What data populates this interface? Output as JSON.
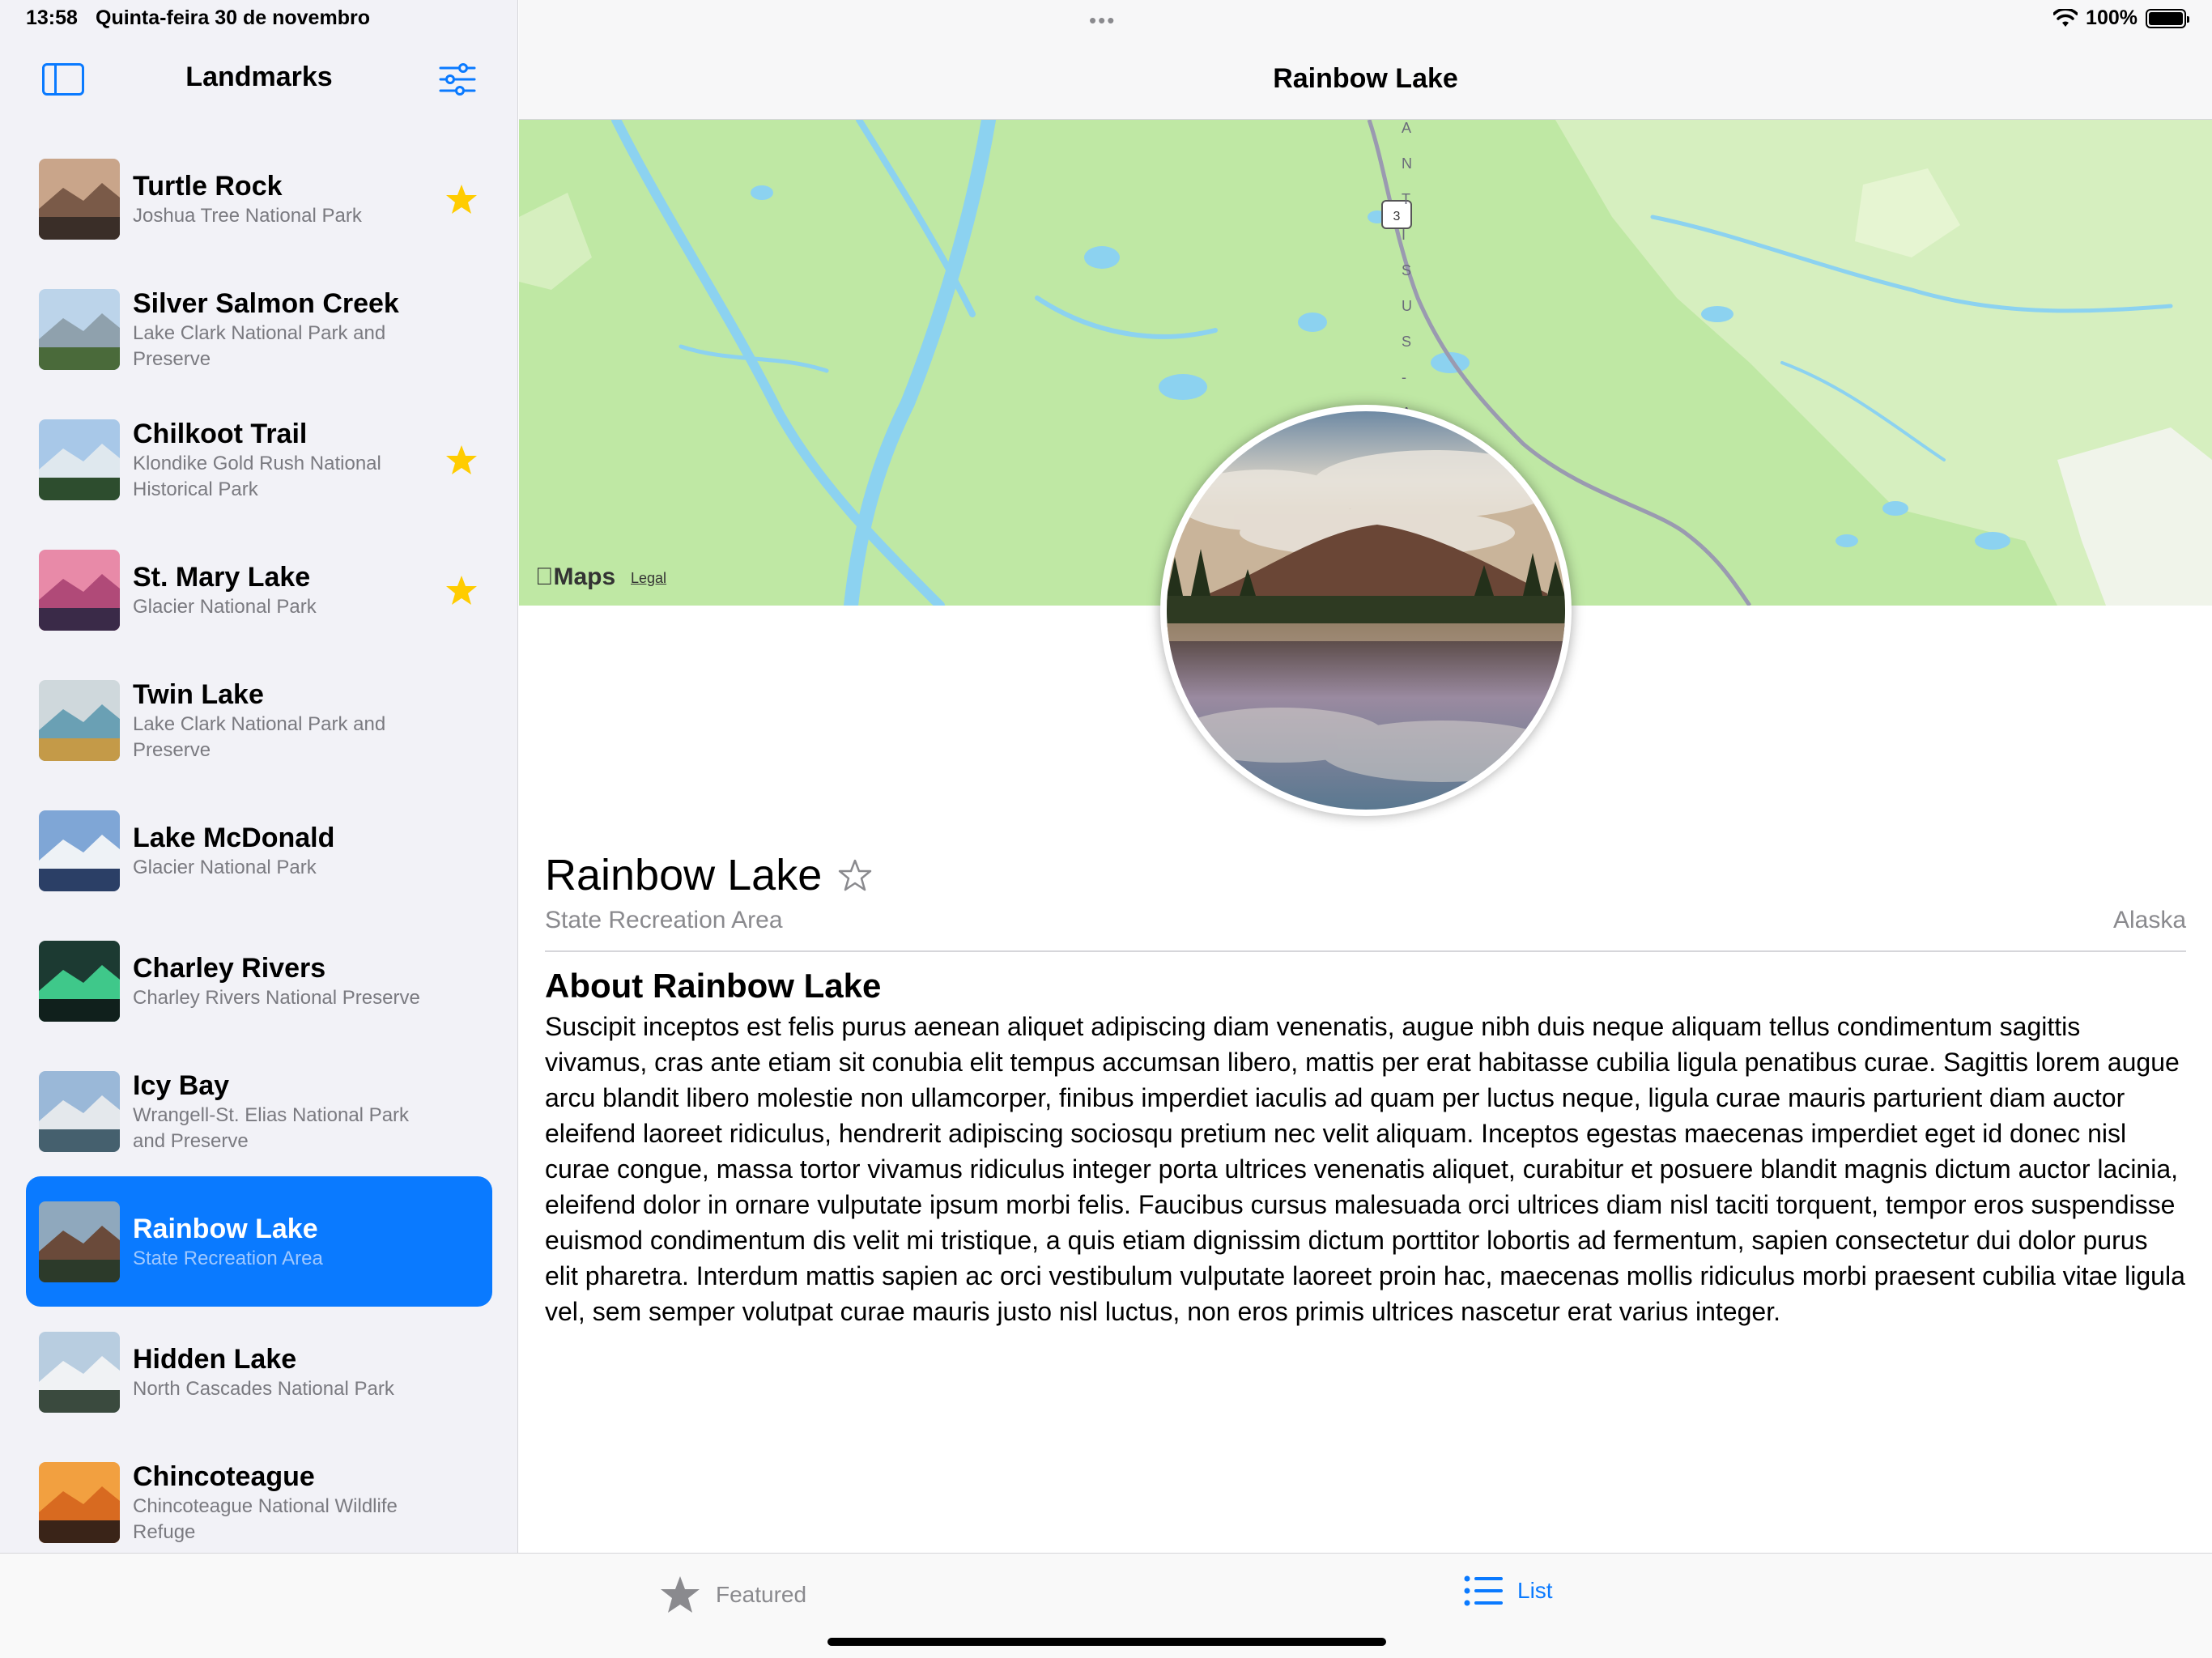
{
  "status_bar": {
    "time": "13:58",
    "date": "Quinta-feira 30 de novembro",
    "battery": "100%"
  },
  "sidebar": {
    "title": "Landmarks",
    "items": [
      {
        "name": "Turtle Rock",
        "subtitle": "Joshua Tree National Park",
        "favorite": true,
        "selected": false,
        "thumb": [
          "#c9a58a",
          "#7a5a48",
          "#3a2e28"
        ]
      },
      {
        "name": "Silver Salmon Creek",
        "subtitle": "Lake Clark National Park and Preserve",
        "favorite": false,
        "selected": false,
        "thumb": [
          "#bcd4ea",
          "#8fa1ad",
          "#4a6a3a"
        ]
      },
      {
        "name": "Chilkoot Trail",
        "subtitle": "Klondike Gold Rush National Historical Park",
        "favorite": true,
        "selected": false,
        "thumb": [
          "#a8c8e8",
          "#dfe8ee",
          "#2d4d2e"
        ]
      },
      {
        "name": "St. Mary Lake",
        "subtitle": "Glacier National Park",
        "favorite": true,
        "selected": false,
        "thumb": [
          "#e88aa8",
          "#b04a78",
          "#3a2a48"
        ]
      },
      {
        "name": "Twin Lake",
        "subtitle": "Lake Clark National Park and Preserve",
        "favorite": false,
        "selected": false,
        "thumb": [
          "#cfd8dc",
          "#6aa0b4",
          "#c49a48"
        ]
      },
      {
        "name": "Lake McDonald",
        "subtitle": "Glacier National Park",
        "favorite": false,
        "selected": false,
        "thumb": [
          "#7fa6d6",
          "#eef2f6",
          "#2b3f66"
        ]
      },
      {
        "name": "Charley Rivers",
        "subtitle": "Charley Rivers National Preserve",
        "favorite": false,
        "selected": false,
        "thumb": [
          "#1c3a32",
          "#3fc88a",
          "#10201c"
        ]
      },
      {
        "name": "Icy Bay",
        "subtitle": "Wrangell-St. Elias National Park and Preserve",
        "favorite": false,
        "selected": false,
        "thumb": [
          "#9ab8d8",
          "#e4e8ec",
          "#45606e"
        ]
      },
      {
        "name": "Rainbow Lake",
        "subtitle": "State Recreation Area",
        "favorite": false,
        "selected": true,
        "thumb": [
          "#8fa8bd",
          "#6a4a3a",
          "#2c3a2a"
        ]
      },
      {
        "name": "Hidden Lake",
        "subtitle": "North Cascades National Park",
        "favorite": false,
        "selected": false,
        "thumb": [
          "#b8cde0",
          "#f0f2f4",
          "#3a4a3e"
        ]
      },
      {
        "name": "Chincoteague",
        "subtitle": "Chincoteague National Wildlife Refuge",
        "favorite": false,
        "selected": false,
        "thumb": [
          "#f2a040",
          "#d86a20",
          "#3a2418"
        ]
      }
    ]
  },
  "detail": {
    "nav_title": "Rainbow Lake",
    "name": "Rainbow Lake",
    "park": "State Recreation Area",
    "state": "Alaska",
    "about_title": "About Rainbow Lake",
    "description": "Suscipit inceptos est felis purus aenean aliquet adipiscing diam venenatis, augue nibh duis neque aliquam tellus condimentum sagittis vivamus, cras ante etiam sit conubia elit tempus accumsan libero, mattis per erat habitasse cubilia ligula penatibus curae. Sagittis lorem augue arcu blandit libero molestie non ullamcorper, finibus imperdiet iaculis ad quam per luctus neque, ligula curae mauris parturient diam auctor eleifend laoreet ridiculus, hendrerit adipiscing sociosqu pretium nec velit aliquam. Inceptos egestas maecenas imperdiet eget id donec nisl curae congue, massa tortor vivamus ridiculus integer porta ultrices venenatis aliquet, curabitur et posuere blandit magnis dictum auctor lacinia, eleifend dolor in ornare vulputate ipsum morbi felis. Faucibus cursus malesuada orci ultrices diam nisl taciti torquent, tempor eros suspendisse euismod condimentum dis velit mi tristique, a quis etiam dignissim dictum porttitor lobortis ad fermentum, sapien consectetur dui dolor purus elit pharetra. Interdum mattis sapien ac orci vestibulum vulputate laoreet proin hac, maecenas mollis ridiculus morbi praesent cubilia vitae ligula vel, sem semper volutpat curae mauris justo nisl luctus, non eros primis ultrices nascetur erat varius integer.",
    "favorite": false,
    "map": {
      "attribution": "Maps",
      "legal": "Legal",
      "road_label": "MATANUSKA-SUSITNA",
      "shield": "3",
      "colors": {
        "land": "#bfe8a4",
        "water": "#8cd2f0",
        "forest": "#d8f0c0",
        "road": "#9a9ab0"
      }
    }
  },
  "tabs": [
    {
      "label": "Featured",
      "icon": "star-icon",
      "active": false
    },
    {
      "label": "List",
      "icon": "list-icon",
      "active": true
    }
  ],
  "colors": {
    "accent": "#0a7aff",
    "favorite": "#ffcc00",
    "secondary_text": "#8a8a8e"
  }
}
